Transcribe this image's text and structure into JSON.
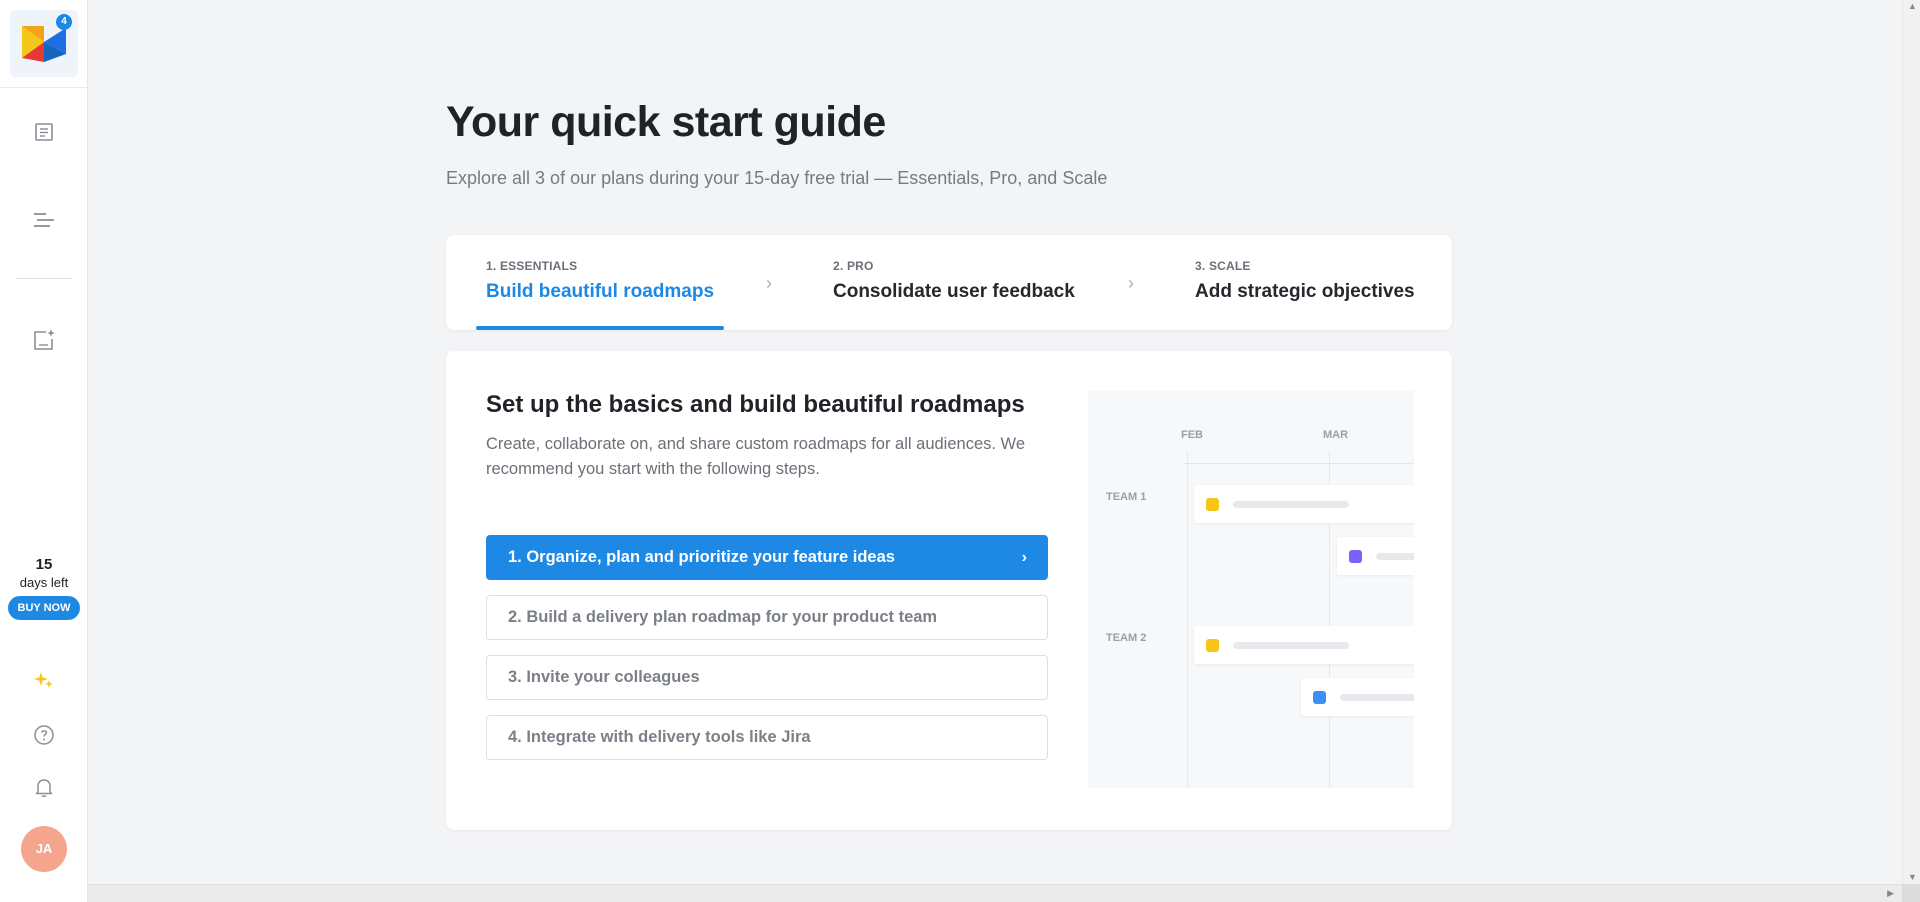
{
  "sidebar": {
    "logo_badge": "4",
    "trial": {
      "days": "15",
      "label": "days left",
      "buy_label": "BUY NOW"
    },
    "avatar_initials": "JA"
  },
  "header": {
    "title": "Your quick start guide",
    "subtitle": "Explore all 3 of our plans during your 15-day free trial — Essentials, Pro, and Scale"
  },
  "plans": [
    {
      "kicker": "1. ESSENTIALS",
      "title": "Build beautiful roadmaps",
      "active": true
    },
    {
      "kicker": "2. PRO",
      "title": "Consolidate user feedback",
      "active": false
    },
    {
      "kicker": "3. SCALE",
      "title": "Add strategic objectives",
      "active": false
    }
  ],
  "card": {
    "title": "Set up the basics and build beautiful roadmaps",
    "description": "Create, collaborate on, and share custom roadmaps for all audiences. We recommend you start with the following steps.",
    "steps": [
      {
        "label": "1. Organize, plan and prioritize your feature ideas",
        "active": true
      },
      {
        "label": "2. Build a delivery plan roadmap for your product team",
        "active": false
      },
      {
        "label": "3. Invite your colleagues",
        "active": false
      },
      {
        "label": "4. Integrate with delivery tools like Jira",
        "active": false
      }
    ],
    "illustration": {
      "months": [
        "FEB",
        "MAR"
      ],
      "teams": [
        "TEAM 1",
        "TEAM 2"
      ]
    }
  },
  "colors": {
    "accent": "#1e88e5",
    "yellow": "#f5c518",
    "purple": "#7b61ff",
    "blue": "#3d8ff5",
    "avatar": "#f5a58e"
  }
}
